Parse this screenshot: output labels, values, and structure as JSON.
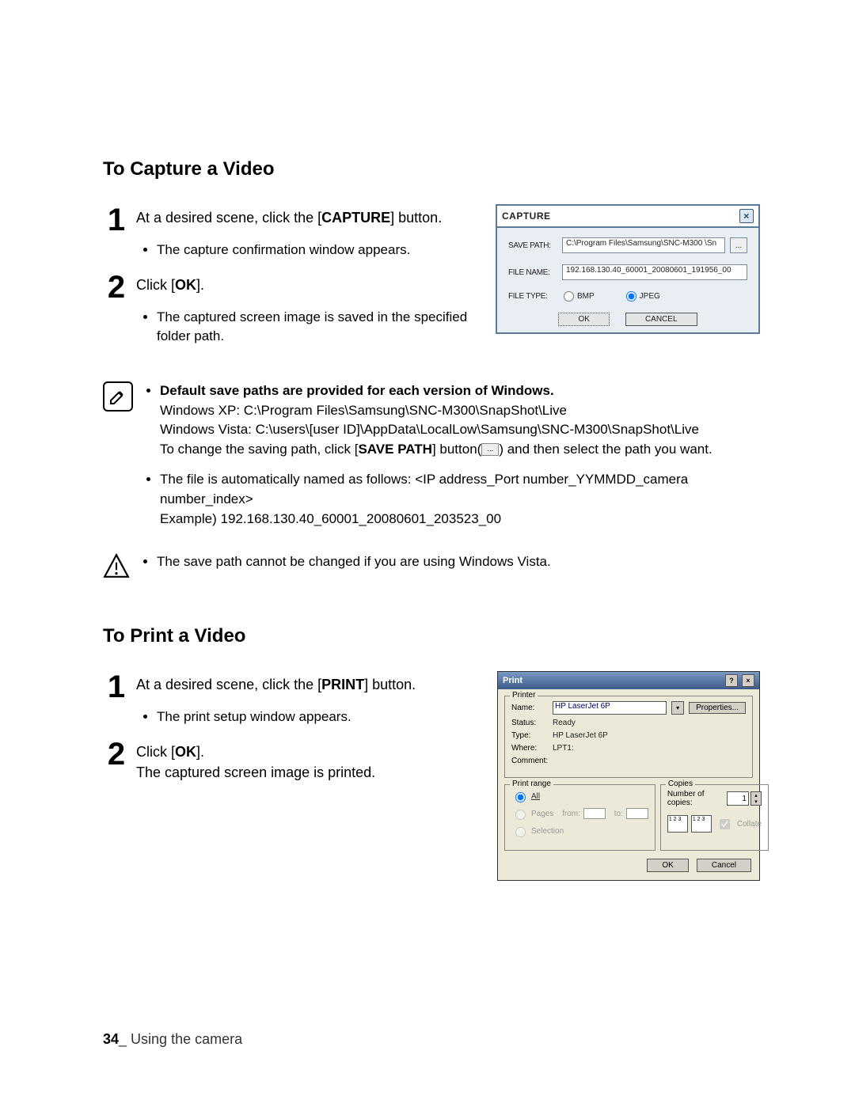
{
  "sections": {
    "capture_heading": "To Capture a Video",
    "print_heading": "To Print a Video"
  },
  "capture_steps": {
    "s1_pre": "At a desired scene, click the [",
    "s1_bold": "CAPTURE",
    "s1_post": "] button.",
    "s1_sub": "The capture confirmation window appears.",
    "s2_pre": "Click [",
    "s2_bold": "OK",
    "s2_post": "].",
    "s2_sub": "The captured screen image is saved in the specified folder path."
  },
  "capture_dialog": {
    "title": "CAPTURE",
    "save_path_label": "SAVE PATH:",
    "save_path_value": "C:\\Program Files\\Samsung\\SNC-M300 \\Sn",
    "file_name_label": "FILE NAME:",
    "file_name_value": "192.168.130.40_60001_20080601_191956_00",
    "file_type_label": "FILE TYPE:",
    "file_type_bmp": "BMP",
    "file_type_jpeg": "JPEG",
    "ok": "OK",
    "cancel": "CANCEL",
    "dots": "..."
  },
  "note": {
    "line1_bold": "Default save paths are provided for each version of Windows.",
    "line2": "Windows XP: C:\\Program Files\\Samsung\\SNC-M300\\SnapShot\\Live",
    "line3": "Windows Vista: C:\\users\\[user ID]\\AppData\\LocalLow\\Samsung\\SNC-M300\\SnapShot\\Live",
    "line4_pre": "To change the saving path, click [",
    "line4_bold": "SAVE PATH",
    "line4_mid": "] button(",
    "line4_btn": "...",
    "line4_post": ") and then select the path you want.",
    "bullet2a": "The file is automatically named as follows: <IP address_Port number_YYMMDD_camera number_index>",
    "bullet2b": "Example) 192.168.130.40_60001_20080601_203523_00"
  },
  "warn": {
    "text": "The save path cannot be changed if you are using Windows Vista."
  },
  "print_steps": {
    "s1_pre": "At a desired scene, click the [",
    "s1_bold": "PRINT",
    "s1_post": "] button.",
    "s1_sub": "The print setup window appears.",
    "s2_pre": "Click [",
    "s2_bold": "OK",
    "s2_post": "].",
    "s2_line": "The captured screen image is printed."
  },
  "print_dialog": {
    "title": "Print",
    "printer_legend": "Printer",
    "name_label": "Name:",
    "name_value": "HP LaserJet 6P",
    "properties": "Properties...",
    "status_label": "Status:",
    "status_value": "Ready",
    "type_label": "Type:",
    "type_value": "HP LaserJet 6P",
    "where_label": "Where:",
    "where_value": "LPT1:",
    "comment_label": "Comment:",
    "range_legend": "Print range",
    "range_all": "All",
    "range_pages": "Pages",
    "range_from": "from:",
    "range_to": "to:",
    "range_selection": "Selection",
    "copies_legend": "Copies",
    "copies_label": "Number of copies:",
    "copies_value": "1",
    "collate": "Collate",
    "ok": "OK",
    "cancel": "Cancel",
    "help_btn": "?",
    "close_btn": "×"
  },
  "footer": {
    "page": "34",
    "sep": "_ ",
    "chapter": "Using the camera"
  }
}
